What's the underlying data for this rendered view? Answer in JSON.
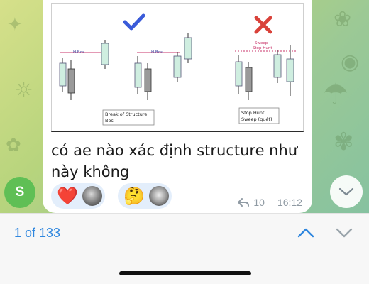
{
  "message": {
    "text": "có ae nào xác định structure như này không",
    "replies": "10",
    "time": "16:12"
  },
  "diagram": {
    "bos_label_1": "H-Bos",
    "bos_label_2": "H-Bos",
    "sweep_label_1": "Sweep",
    "sweep_label_2": "Stop Hunt",
    "caption_left_1": "Break of Structure",
    "caption_left_2": "Bos",
    "caption_right_1": "Stop Hunt",
    "caption_right_2": "Sweep (quét)"
  },
  "reactions": [
    {
      "emoji": "heart",
      "glyph": "❤️"
    },
    {
      "emoji": "thinking-face",
      "glyph": "🤔"
    }
  ],
  "sender": {
    "initial": "S",
    "color": "#5fbf55"
  },
  "search": {
    "counter": "1 of 133"
  },
  "colors": {
    "accent": "#2e86de",
    "check": "#3a5bd9",
    "cross": "#d9423a",
    "candle": "#cfeee0"
  }
}
